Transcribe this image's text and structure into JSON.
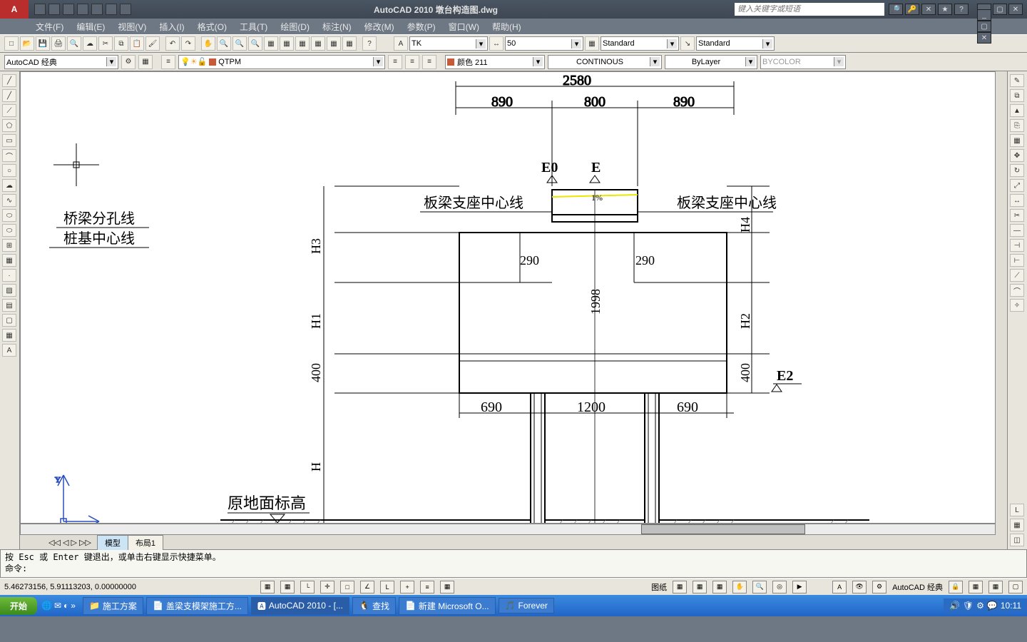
{
  "title": "AutoCAD 2010  墩台构造图.dwg",
  "search_placeholder": "键入关键字或短语",
  "menu": [
    "文件(F)",
    "编辑(E)",
    "视图(V)",
    "插入(I)",
    "格式(O)",
    "工具(T)",
    "绘图(D)",
    "标注(N)",
    "修改(M)",
    "参数(P)",
    "窗口(W)",
    "帮助(H)"
  ],
  "toolbar1": {
    "textstyle_label": "TK",
    "dim_label": "50",
    "style_label": "Standard",
    "table_label": "Standard"
  },
  "toolbar2": {
    "workspace": "AutoCAD 经典",
    "layer": "QTPM",
    "color": "颜色 211",
    "linetype": "CONTINOUS",
    "lineweight": "ByLayer",
    "bycolor": "BYCOLOR"
  },
  "drawing": {
    "total": "2580",
    "top_dims": [
      "890",
      "800",
      "890"
    ],
    "e0": "E0",
    "e": "E",
    "h3": "H3",
    "h1": "H1",
    "h4": "H4",
    "h2": "H2",
    "h_bottom": "H",
    "v400_l": "400",
    "v400_r": "400",
    "v1998": "1998",
    "inner290a": "290",
    "inner290b": "290",
    "bot_dims": [
      "690",
      "1200",
      "690"
    ],
    "e2": "E2",
    "label_left_seat": "板梁支座中心线",
    "label_right_seat": "板梁支座中心线",
    "label_split": "桥梁分孔线",
    "label_pile": "桩基中心线",
    "label_ground": "原地面标高",
    "label_1pct": "1%"
  },
  "tabs": {
    "model": "模型",
    "layout": "布局1"
  },
  "cmd": {
    "line1": "按 Esc 或 Enter 键退出，或单击右键显示快捷菜单。",
    "line2": "命令:"
  },
  "status": {
    "coords": "5.46273156, 5.91113203, 0.00000000",
    "paper": "图纸",
    "ws": "AutoCAD 经典"
  },
  "taskbar": {
    "start": "开始",
    "items": [
      "施工方案",
      "盖梁支模架施工方...",
      "AutoCAD 2010 - [...",
      "查找",
      "新建 Microsoft O...",
      "Forever"
    ],
    "time": "10:11"
  }
}
